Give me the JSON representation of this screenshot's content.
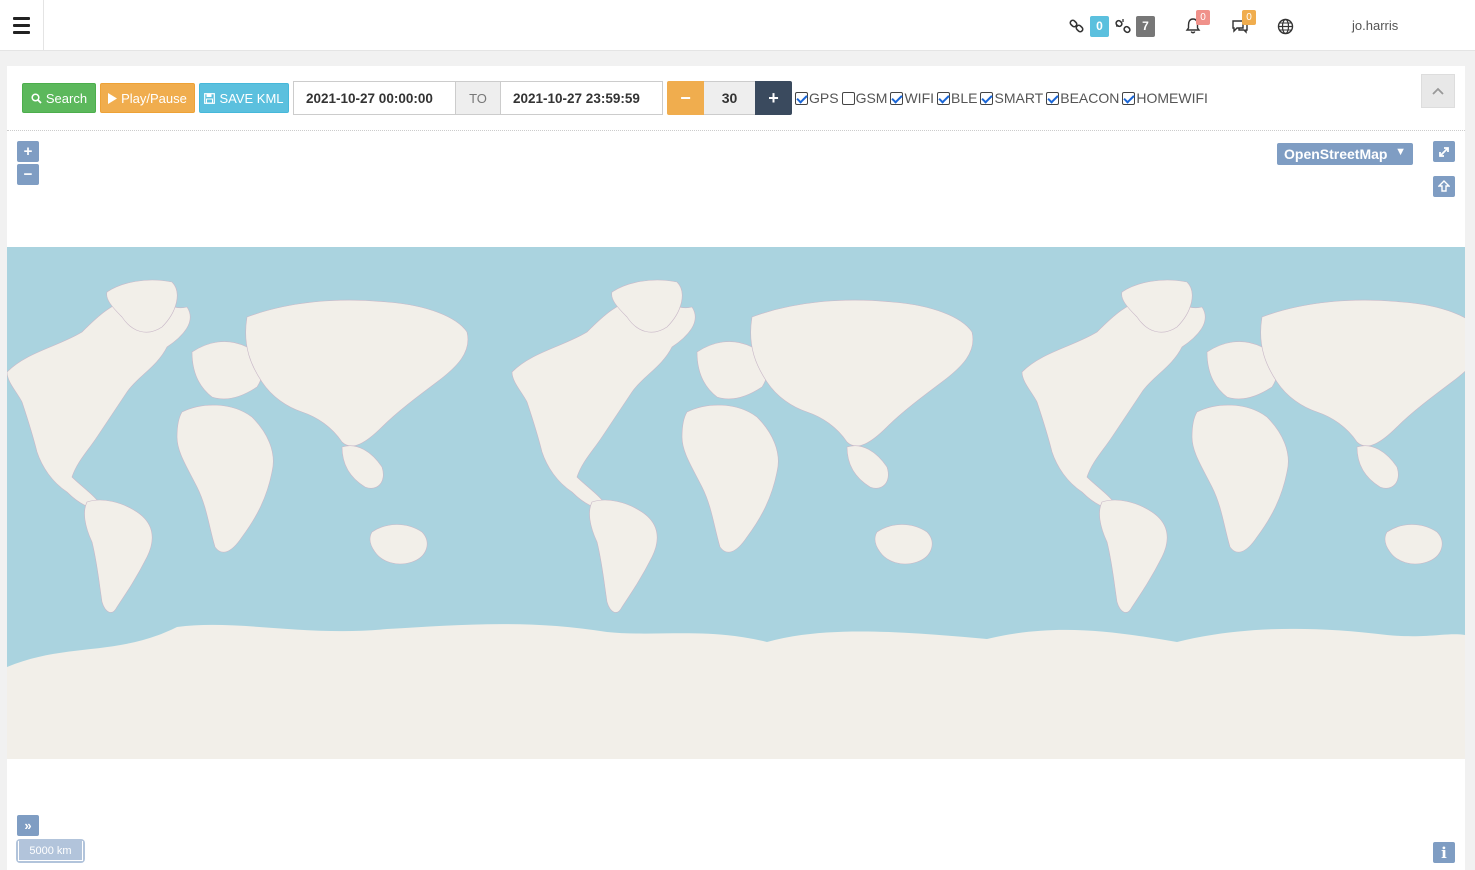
{
  "navbar": {
    "links_badge": "0",
    "broken_links_badge": "7",
    "alerts_badge": "0",
    "messages_badge": "0",
    "username": "jo.harris",
    "colors": {
      "links": "#5bc0de",
      "broken": "#777777",
      "alerts": "#f0918a",
      "messages": "#f0ad4e"
    }
  },
  "toolbar": {
    "search_label": "Search",
    "play_label": "Play/Pause",
    "save_kml_label": "SAVE KML",
    "date_from": "2021-10-27 00:00:00",
    "to_label": "TO",
    "date_to": "2021-10-27 23:59:59",
    "step_value": "30",
    "filters": [
      {
        "label": "GPS",
        "checked": true
      },
      {
        "label": "GSM",
        "checked": false
      },
      {
        "label": "WIFI",
        "checked": true
      },
      {
        "label": "BLE",
        "checked": true
      },
      {
        "label": "SMART",
        "checked": true
      },
      {
        "label": "BEACON",
        "checked": true
      },
      {
        "label": "HOMEWIFI",
        "checked": true
      }
    ]
  },
  "map": {
    "zoom_in": "+",
    "zoom_out": "−",
    "layer_name": "OpenStreetMap",
    "scale_label": "5000 km",
    "info_label": "i",
    "colors": {
      "ocean": "#aad3df",
      "land": "#f2efe9"
    }
  }
}
